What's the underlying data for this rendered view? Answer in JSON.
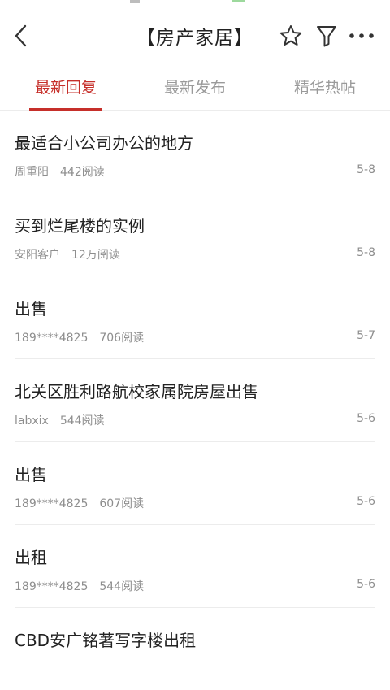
{
  "header": {
    "title": "【房产家居】"
  },
  "tabs": [
    {
      "label": "最新回复",
      "active": true
    },
    {
      "label": "最新发布",
      "active": false
    },
    {
      "label": "精华热帖",
      "active": false
    }
  ],
  "posts": [
    {
      "title": "最适合小公司办公的地方",
      "author": "周重阳",
      "reads": "442阅读",
      "date": "5-8"
    },
    {
      "title": "买到烂尾楼的实例",
      "author": "安阳客户",
      "reads": "12万阅读",
      "date": "5-8"
    },
    {
      "title": "出售",
      "author": "189****4825",
      "reads": "706阅读",
      "date": "5-7"
    },
    {
      "title": "北关区胜利路航校家属院房屋出售",
      "author": "labxix",
      "reads": "544阅读",
      "date": "5-6"
    },
    {
      "title": "出售",
      "author": "189****4825",
      "reads": "607阅读",
      "date": "5-6"
    },
    {
      "title": "出租",
      "author": "189****4825",
      "reads": "544阅读",
      "date": "5-6"
    },
    {
      "title": "CBD安广铭著写字楼出租"
    }
  ],
  "colors": {
    "accent": "#c62f2a",
    "text": "#222222",
    "meta": "#8e8e8e",
    "divider": "#ececec"
  },
  "icons": [
    "back-icon",
    "star-icon",
    "filter-icon",
    "more-icon"
  ]
}
